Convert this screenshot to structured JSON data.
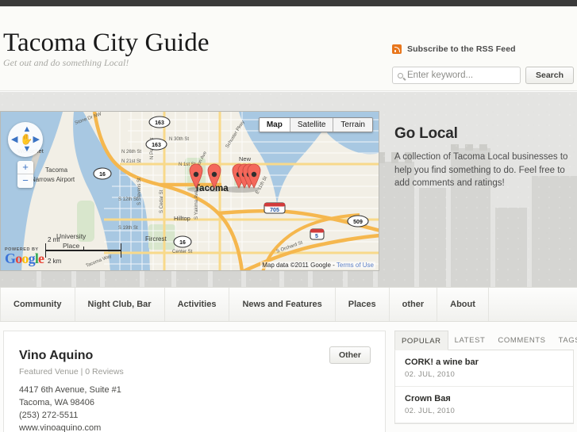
{
  "header": {
    "site_title": "Tacoma City Guide",
    "tagline": "Get out and do something Local!",
    "rss_label": "Subscribe to the RSS Feed",
    "rss_icon": "rss-icon",
    "search_placeholder": "Enter keyword...",
    "search_value": "",
    "search_button": "Search",
    "search_icon": "magnifier-icon"
  },
  "map": {
    "types": [
      {
        "label": "Map",
        "active": true
      },
      {
        "label": "Satellite",
        "active": false
      },
      {
        "label": "Terrain",
        "active": false
      }
    ],
    "pan": {
      "up": "▲",
      "down": "▼",
      "left": "◀",
      "right": "▶",
      "hand": "✋"
    },
    "zoom_in": "+",
    "zoom_out": "−",
    "powered_by": "POWERED BY",
    "google_letters": [
      "G",
      "o",
      "o",
      "g",
      "l",
      "e"
    ],
    "scale_miles": "2 mi",
    "scale_km": "2 km",
    "attribution": "Map data ©2011 Google - ",
    "attribution_link": "Terms of Use",
    "city_label": "Tacoma",
    "place_labels": [
      "Wollochet",
      "Tacoma",
      "Narrows Airport",
      "University",
      "Place",
      "Fircrest",
      "Hilltop",
      "Tacoma",
      "New",
      "Tacoma"
    ],
    "street_labels": [
      "N 30th St",
      "N 26th St",
      "N 21st St",
      "N 1st St",
      "S 12th St",
      "S 19th St",
      "Center St",
      "S Stevens St",
      "S Cedar St",
      "S Yakima Ave",
      "Division Ave",
      "Schuster Pkwy",
      "E 11th St",
      "N Pearl St",
      "S Orchard St",
      "Tacoma Way",
      "Stone Dr NW"
    ],
    "highway_shields": [
      "163",
      "163",
      "16",
      "16",
      "705",
      "5",
      "509"
    ],
    "marker_count": 7
  },
  "hero": {
    "heading": "Go Local",
    "body": "A collection of Tacoma Local businesses to help you find something to do.  Feel free to add comments and ratings!"
  },
  "nav": {
    "items": [
      {
        "label": "Community"
      },
      {
        "label": "Night Club, Bar"
      },
      {
        "label": "Activities"
      },
      {
        "label": "News and Features"
      },
      {
        "label": "Places"
      },
      {
        "label": "other"
      },
      {
        "label": "About"
      }
    ]
  },
  "venue": {
    "name": "Vino Aquino",
    "meta": "Featured Venue | 0 Reviews",
    "address_line1": "4417 6th Avenue, Suite #1",
    "address_line2": "Tacoma, WA 98406",
    "phone": "(253) 272-5511",
    "website": "www.vinoaquino.com",
    "category_badge": "Other"
  },
  "sidebar": {
    "tabs": [
      {
        "label": "POPULAR",
        "active": true
      },
      {
        "label": "LATEST",
        "active": false
      },
      {
        "label": "COMMENTS",
        "active": false
      },
      {
        "label": "TAGS",
        "active": false
      }
    ],
    "items": [
      {
        "title": "CORK! a wine bar",
        "date": "02. JUL, 2010"
      },
      {
        "title": "Crown Baя",
        "date": "02. JUL, 2010"
      }
    ]
  },
  "colors": {
    "topbar": "#3a3a3a",
    "rss_orange": "#e8761c",
    "map_marker": "#f4685b",
    "link_blue": "#5b7fc7",
    "hero_bg": "#e4e4e2"
  }
}
